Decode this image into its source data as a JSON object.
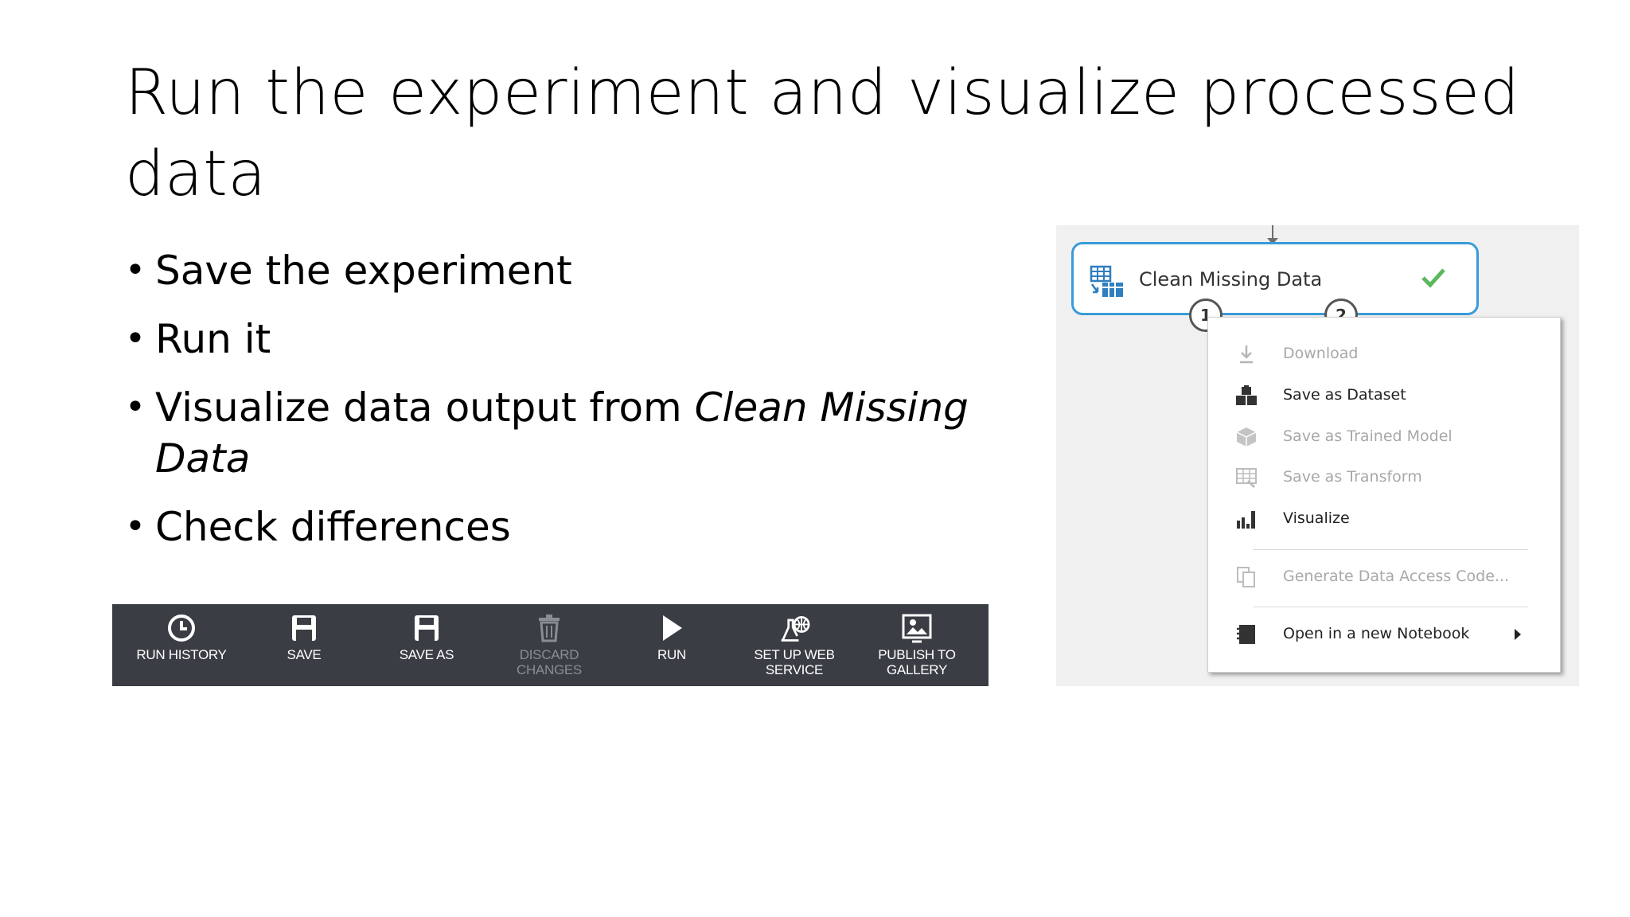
{
  "slide": {
    "title": "Run the experiment and visualize processed data",
    "bullets": [
      {
        "text": "Save the experiment"
      },
      {
        "text": "Run it"
      },
      {
        "text": "Visualize data output from ",
        "italic": "Clean Missing Data"
      },
      {
        "text": "Check differences"
      }
    ],
    "bullet_char": "•"
  },
  "toolbar": {
    "items": [
      {
        "label": "RUN HISTORY",
        "icon": "clock-icon",
        "disabled": false
      },
      {
        "label": "SAVE",
        "icon": "floppy-disk-icon",
        "disabled": false
      },
      {
        "label": "SAVE AS",
        "icon": "floppy-disk-icon",
        "disabled": false
      },
      {
        "label": "DISCARD\nCHANGES",
        "icon": "trash-icon",
        "disabled": true
      },
      {
        "label": "RUN",
        "icon": "play-icon",
        "disabled": false
      },
      {
        "label": "SET UP WEB\nSERVICE",
        "icon": "web-service-icon",
        "disabled": false
      },
      {
        "label": "PUBLISH TO\nGALLERY",
        "icon": "publish-gallery-icon",
        "disabled": false
      }
    ]
  },
  "module": {
    "name": "Clean Missing Data",
    "status": "completed",
    "ports": [
      "1",
      "2"
    ],
    "border_color": "#3a9bd8",
    "check_color": "#5cb85c"
  },
  "context_menu": {
    "items": [
      {
        "label": "Download",
        "icon": "download-icon",
        "disabled": true
      },
      {
        "label": "Save as Dataset",
        "icon": "dataset-icon",
        "disabled": false
      },
      {
        "label": "Save as Trained Model",
        "icon": "trained-model-icon",
        "disabled": true
      },
      {
        "label": "Save as Transform",
        "icon": "transform-icon",
        "disabled": true
      },
      {
        "label": "Visualize",
        "icon": "bar-chart-icon",
        "disabled": false
      },
      {
        "label": "Generate Data Access Code...",
        "icon": "copy-code-icon",
        "disabled": true
      },
      {
        "label": "Open in a new Notebook",
        "icon": "notebook-icon",
        "disabled": false,
        "has_submenu": true
      }
    ]
  }
}
